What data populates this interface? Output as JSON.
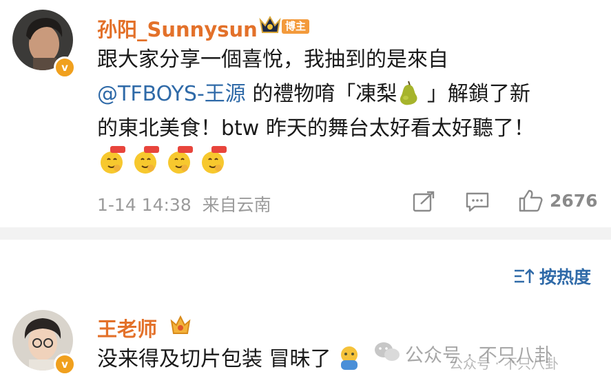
{
  "post": {
    "author": "孙阳_Sunnysun",
    "author_badge": "博主",
    "lines": [
      "跟大家分享一個喜悅，我抽到的是來自",
      "@TFBOYS-王源",
      " 的禮物唷「凍梨",
      " 」解鎖了新",
      "的東北美食！btw 昨天的舞台太好看太好聽了！"
    ],
    "timestamp": "1-14 14:38",
    "source": "来自云南",
    "likes": "2676",
    "verified_mark": "v"
  },
  "comments_header": {
    "sort_label": "按热度"
  },
  "comment": {
    "author": "王老师",
    "text": "没来得及切片包装 冒昧了",
    "verified_mark": "v"
  },
  "watermark": {
    "text": "公众号 · 不只八卦",
    "text2": "公众号 · 不只八卦"
  },
  "colors": {
    "name": "#e3712a",
    "mention": "#2f6aa8",
    "meta": "#9b9b9b",
    "badge": "#f0a01e"
  }
}
